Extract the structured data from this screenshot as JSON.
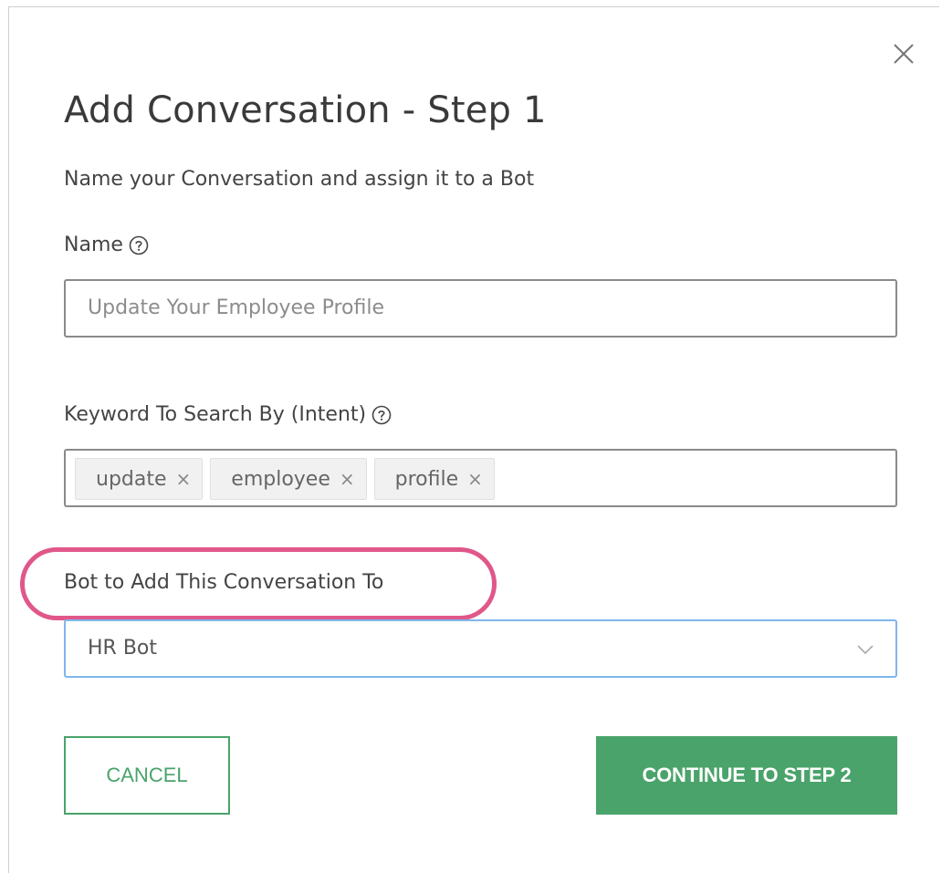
{
  "modal": {
    "title": "Add Conversation - Step 1",
    "subtitle": "Name your Conversation and assign it to a Bot",
    "close_icon": "close-icon"
  },
  "name_field": {
    "label": "Name",
    "placeholder": "Update Your Employee Profile",
    "help_icon": "help-circle-icon"
  },
  "keyword_field": {
    "label": "Keyword To Search By (Intent)",
    "help_icon": "help-circle-icon",
    "tags": [
      {
        "text": "update",
        "remove": "×"
      },
      {
        "text": "employee",
        "remove": "×"
      },
      {
        "text": "profile",
        "remove": "×"
      }
    ]
  },
  "bot_field": {
    "label": "Bot to Add This Conversation To",
    "selected": "HR Bot",
    "chevron_icon": "chevron-down-icon"
  },
  "buttons": {
    "cancel": "CANCEL",
    "continue": "CONTINUE TO STEP 2"
  },
  "colors": {
    "accent_green": "#4aa36a",
    "highlight_pink": "#e0578a",
    "select_focus_blue": "#7fb6ec"
  }
}
